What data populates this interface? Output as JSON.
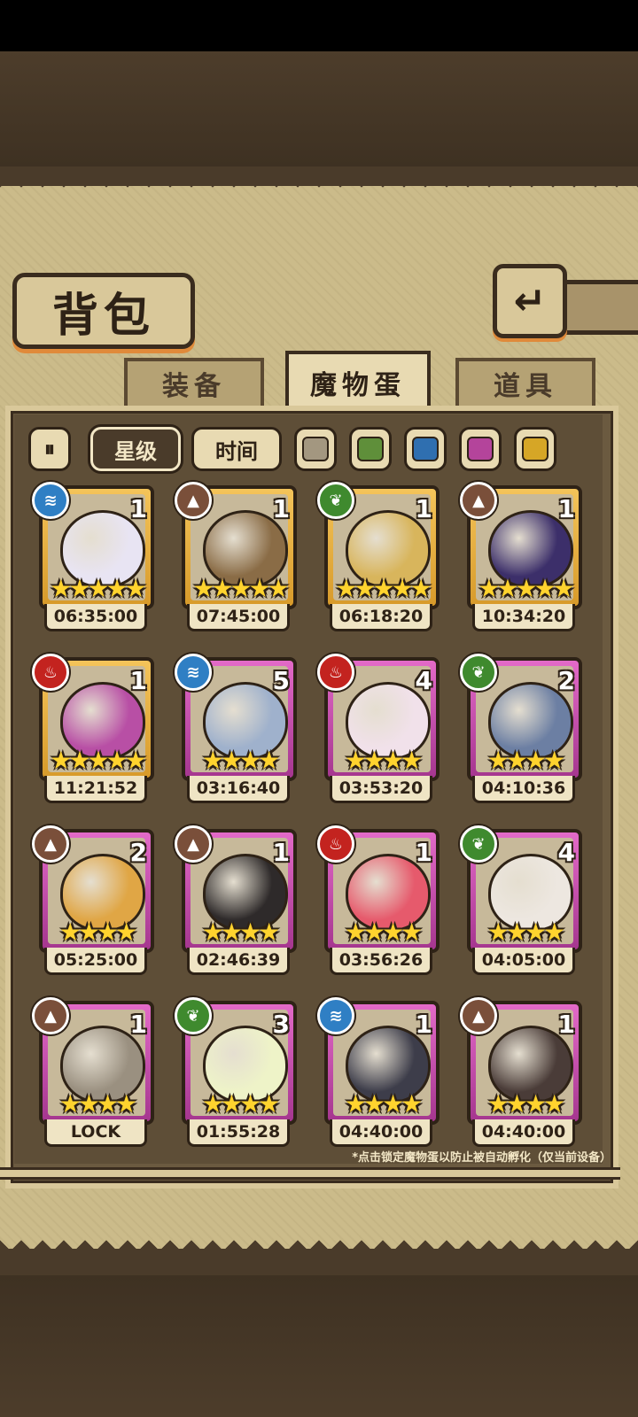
{
  "header": {
    "title": "背包",
    "back_icon": "return-arrow-icon"
  },
  "tabs": [
    {
      "label": "装备",
      "active": false
    },
    {
      "label": "魔物蛋",
      "active": true
    },
    {
      "label": "道具",
      "active": false
    }
  ],
  "filters": {
    "sort_toggle_icon": "sort-toggle-icon",
    "star_label": "星级",
    "time_label": "时间",
    "color_swatches": [
      "#a39780",
      "#5f8f3a",
      "#2f6fb0",
      "#b4449b",
      "#d6a626"
    ]
  },
  "eggs": [
    {
      "element": "water",
      "level": "1",
      "rarity": "gold",
      "stars": "★★★★★",
      "timer": "06:35:00",
      "color": "#e8e4f3"
    },
    {
      "element": "earth",
      "level": "1",
      "rarity": "gold",
      "stars": "★★★★★",
      "timer": "07:45:00",
      "color": "#8a6c46"
    },
    {
      "element": "nature",
      "level": "1",
      "rarity": "gold",
      "stars": "★★★★★",
      "timer": "06:18:20",
      "color": "#d8b55c"
    },
    {
      "element": "earth",
      "level": "1",
      "rarity": "gold",
      "stars": "★★★★★",
      "timer": "10:34:20",
      "color": "#3c2f6a"
    },
    {
      "element": "fire",
      "level": "1",
      "rarity": "gold",
      "stars": "★★★★★",
      "timer": "11:21:52",
      "color": "#b84fa5"
    },
    {
      "element": "water",
      "level": "5",
      "rarity": "purple",
      "stars": "★★★★",
      "timer": "03:16:40",
      "color": "#9fb1cc"
    },
    {
      "element": "fire",
      "level": "4",
      "rarity": "purple",
      "stars": "★★★★",
      "timer": "03:53:20",
      "color": "#f1e1ea"
    },
    {
      "element": "nature",
      "level": "2",
      "rarity": "purple",
      "stars": "★★★★",
      "timer": "04:10:36",
      "color": "#6c7fa3"
    },
    {
      "element": "earth",
      "level": "2",
      "rarity": "purple",
      "stars": "★★★★",
      "timer": "05:25:00",
      "color": "#e0a645"
    },
    {
      "element": "earth",
      "level": "1",
      "rarity": "purple",
      "stars": "★★★★",
      "timer": "02:46:39",
      "color": "#2e2a2a"
    },
    {
      "element": "fire",
      "level": "1",
      "rarity": "purple",
      "stars": "★★★★",
      "timer": "03:56:26",
      "color": "#e65a6c"
    },
    {
      "element": "nature",
      "level": "4",
      "rarity": "purple",
      "stars": "★★★★",
      "timer": "04:05:00",
      "color": "#ede7e0"
    },
    {
      "element": "earth",
      "level": "1",
      "rarity": "purple",
      "stars": "★★★★",
      "timer": "LOCK",
      "color": "#9a9080"
    },
    {
      "element": "nature",
      "level": "3",
      "rarity": "purple",
      "stars": "★★★★",
      "timer": "01:55:28",
      "color": "#eef3c8"
    },
    {
      "element": "water",
      "level": "1",
      "rarity": "purple",
      "stars": "★★★★",
      "timer": "04:40:00",
      "color": "#3d3d4a"
    },
    {
      "element": "earth",
      "level": "1",
      "rarity": "purple",
      "stars": "★★★★",
      "timer": "04:40:00",
      "color": "#4a3c38"
    }
  ],
  "element_glyphs": {
    "water": "≋",
    "earth": "▲",
    "nature": "❦",
    "fire": "♨"
  },
  "footer_note": "*点击锁定魔物蛋以防止被自动孵化（仅当前设备）"
}
